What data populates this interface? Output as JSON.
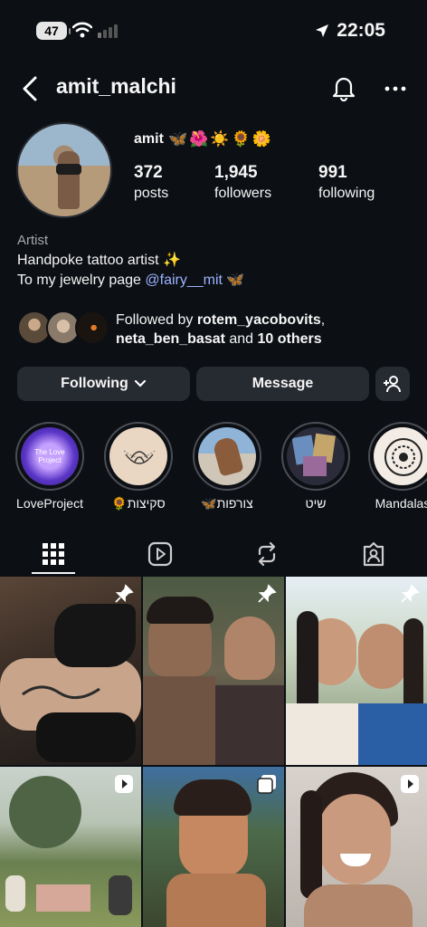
{
  "status_bar": {
    "battery": "47",
    "time": "22:05"
  },
  "header": {
    "username": "amit_malchi"
  },
  "profile": {
    "display_name": "amit",
    "emojis": "🦋🌺☀️🌻🌼",
    "stats": [
      {
        "value": "372",
        "label": "posts"
      },
      {
        "value": "1,945",
        "label": "followers"
      },
      {
        "value": "991",
        "label": "following"
      }
    ],
    "category": "Artist",
    "bio_line1": "Handpoke tattoo artist  ✨",
    "bio_line2_prefix": "To my jewelry page ",
    "bio_line2_link": "@fairy__mit",
    "bio_line2_suffix": " 🦋",
    "mutual": {
      "prefix": "Followed by ",
      "user1": "rotem_yacobovits",
      "sep": ",",
      "user2": "neta_ben_basat",
      "and": " and ",
      "others": "10 others"
    }
  },
  "buttons": {
    "following": "Following",
    "message": "Message"
  },
  "highlights": [
    {
      "label": "LoveProject",
      "inner_text": "The Love Project"
    },
    {
      "label": "🌻סקיצות"
    },
    {
      "label": "🦋צורפות"
    },
    {
      "label": "שיט"
    },
    {
      "label": "Mandalas"
    }
  ],
  "tabs": [
    "grid-tab",
    "reels-tab",
    "reposts-tab",
    "tagged-tab"
  ],
  "grid_posts": [
    {
      "type": "pinned"
    },
    {
      "type": "pinned"
    },
    {
      "type": "pinned"
    },
    {
      "type": "reel"
    },
    {
      "type": "carousel"
    },
    {
      "type": "reel"
    }
  ],
  "colors": {
    "background": "#0c0f14",
    "button": "#262a31",
    "link": "#9cb4ff"
  }
}
